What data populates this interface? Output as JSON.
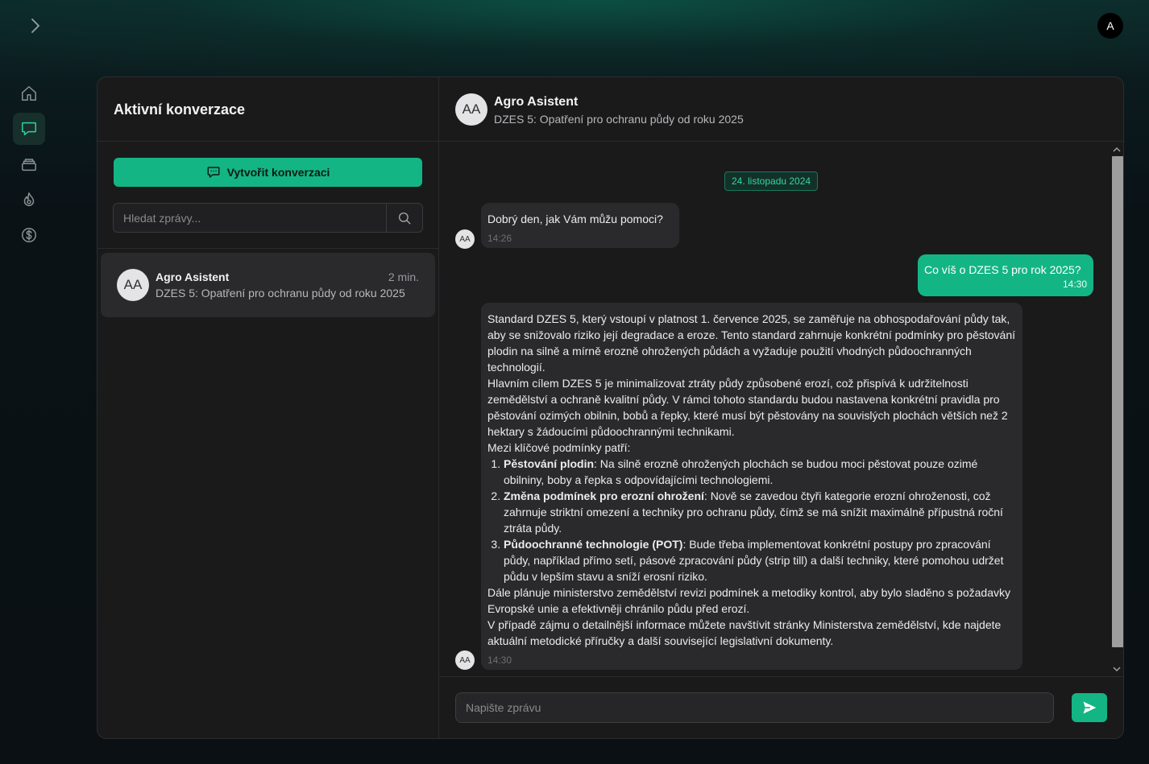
{
  "topbar": {
    "user_initial": "A"
  },
  "sidebar": {
    "items": [
      {
        "icon": "home-icon",
        "active": false
      },
      {
        "icon": "chat-icon",
        "active": true
      },
      {
        "icon": "layers-icon",
        "active": false
      },
      {
        "icon": "flame-icon",
        "active": false
      },
      {
        "icon": "dollar-icon",
        "active": false
      }
    ]
  },
  "conversations_panel": {
    "title": "Aktivní konverzace",
    "create_label": "Vytvořit konverzaci",
    "search_placeholder": "Hledat zprávy...",
    "items": [
      {
        "initials": "AA",
        "name": "Agro Asistent",
        "time": "2 min.",
        "preview": "DZES 5: Opatření pro ochranu půdy od roku 2025"
      }
    ]
  },
  "chat": {
    "header": {
      "initials": "AA",
      "name": "Agro Asistent",
      "subtitle": "DZES 5: Opatření pro ochranu půdy od roku 2025"
    },
    "date": "24. listopadu 2024",
    "messages": [
      {
        "from": "bot",
        "avatar": "AA",
        "text": "Dobrý den, jak Vám můžu pomoci?",
        "time": "14:26"
      },
      {
        "from": "user",
        "text": "Co víš o DZES 5 pro rok 2025?",
        "time": "14:30"
      },
      {
        "from": "bot",
        "avatar": "AA",
        "p1": "Standard DZES 5, který vstoupí v platnost 1. července 2025, se zaměřuje na obhospodařování půdy tak, aby se snižovalo riziko její degradace a eroze. Tento standard zahrnuje konkrétní podmínky pro pěstování plodin na silně a mírně erozně ohrožených půdách a vyžaduje použití vhodných půdoochranných technologií.",
        "p2": "Hlavním cílem DZES 5 je minimalizovat ztráty půdy způsobené erozí, což přispívá k udržitelnosti zemědělství a ochraně kvalitní půdy. V rámci tohoto standardu budou nastavena konkrétní pravidla pro pěstování ozimých obilnin, bobů a řepky, které musí být pěstovány na souvislých plochách větších než 2 hektary s žádoucími půdoochrannými technikami.",
        "p3": "Mezi klíčové podmínky patří:",
        "list": [
          {
            "title": "Pěstování plodin",
            "text": ": Na silně erozně ohrožených plochách se budou moci pěstovat pouze ozimé obilniny, boby a řepka s odpovídajícími technologiemi."
          },
          {
            "title": "Změna podmínek pro erozní ohrožení",
            "text": ": Nově se zavedou čtyři kategorie erozní ohroženosti, což zahrnuje striktní omezení a techniky pro ochranu půdy, čímž se má snížit maximálně přípustná roční ztráta půdy."
          },
          {
            "title": "Půdoochranné technologie (POT)",
            "text": ": Bude třeba implementovat konkrétní postupy pro zpracování půdy, například přímo setí, pásové zpracování půdy (strip till) a další techniky, které pomohou udržet půdu v lepším stavu a sníží erosní riziko."
          }
        ],
        "p4": "Dále plánuje ministerstvo zemědělství revizi podmínek a metodiky kontrol, aby bylo sladěno s požadavky Evropské unie a efektivněji chránilo půdu před erozí.",
        "p5": "V případě zájmu o detailnější informace můžete navštívit stránky Ministerstva zemědělství, kde najdete aktuální metodické příručky a další související legislativní dokumenty.",
        "time": "14:30"
      }
    ],
    "composer": {
      "placeholder": "Napište zprávu"
    }
  },
  "colors": {
    "accent": "#14b584",
    "panel": "#1a1a1b",
    "bubble": "#2a2a2c"
  }
}
